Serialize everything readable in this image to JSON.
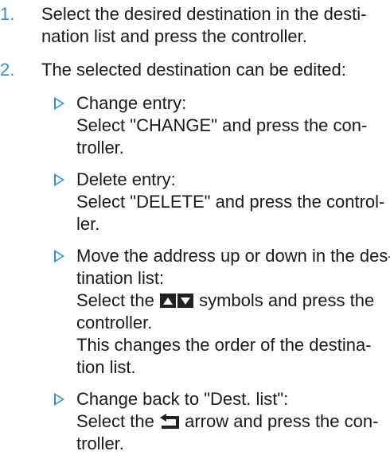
{
  "steps": [
    {
      "number": "1.",
      "lines": [
        "Select the desired destination in the desti-",
        "nation list and press the controller."
      ]
    },
    {
      "number": "2.",
      "lines": [
        "The selected destination can be edited:"
      ]
    }
  ],
  "subitems": [
    {
      "lines": [
        "Change entry:",
        "Select \"CHANGE\" and press the con-",
        "troller."
      ]
    },
    {
      "lines": [
        "Delete entry:",
        "Select \"DELETE\" and press the control-",
        "ler."
      ]
    },
    {
      "lines": [
        "Move the address up or down in the des-",
        "tination list:"
      ],
      "icon_line_before": "Select the",
      "icon_line_after": "symbols and press the",
      "tail_lines": [
        "controller.",
        "This changes the order of the destina-",
        "tion list."
      ],
      "icon": "up-down-arrow-symbols-icon"
    },
    {
      "lines": [
        "Change back to \"Dest. list\":"
      ],
      "icon_line_before": "Select the",
      "icon_line_after": "arrow and press the con-",
      "tail_lines": [
        "troller."
      ],
      "icon": "back-arrow-icon"
    }
  ],
  "colors": {
    "accent": "#2f8fd0",
    "text": "#1a1a1a"
  }
}
